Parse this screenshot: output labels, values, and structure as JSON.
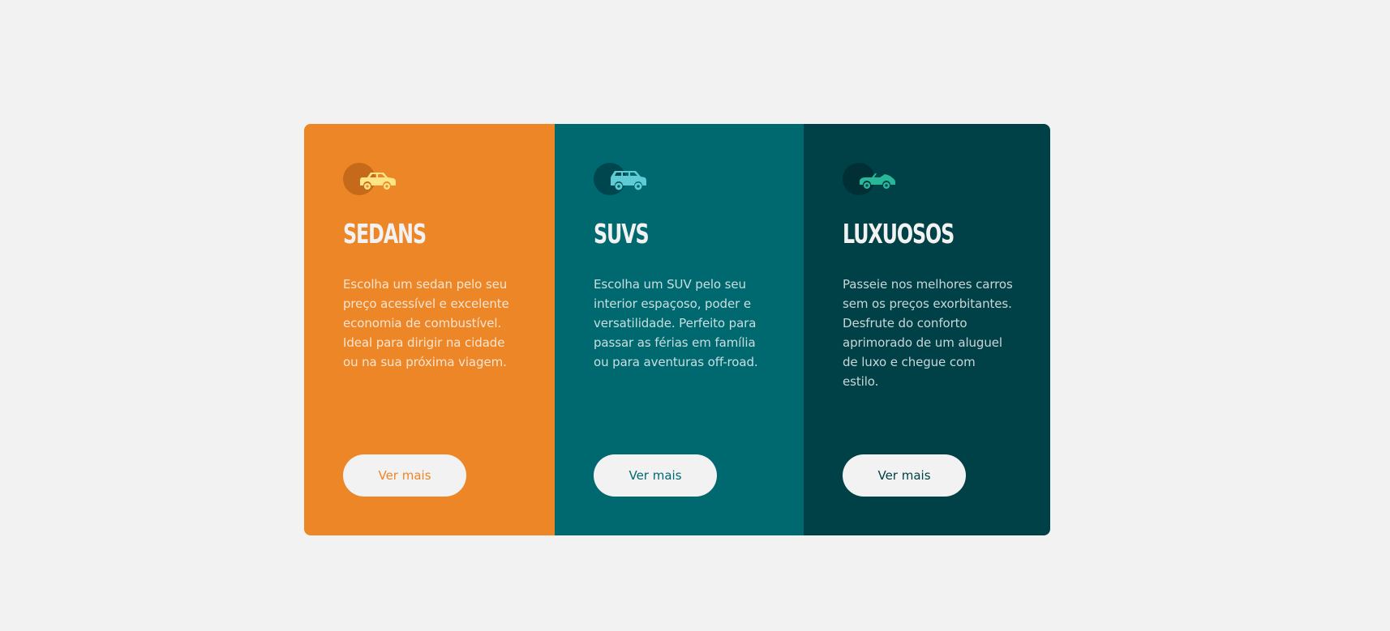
{
  "cards": [
    {
      "key": "sedans",
      "title": "SEDANS",
      "description": "Escolha um sedan pelo seu preço acessível e excelente economia de combustível. Ideal para dirigir na cidade ou na sua próxima viagem.",
      "button_label": "Ver mais",
      "icon": "sedan-car-icon",
      "background": "#ec8627",
      "icon_color": "#ffe484"
    },
    {
      "key": "suvs",
      "title": "SUVS",
      "description": "Escolha um SUV pelo seu interior espaçoso, poder e versatilidade. Perfeito para passar as férias em família ou para aventuras off-road.",
      "button_label": "Ver mais",
      "icon": "suv-car-icon",
      "background": "#006970",
      "icon_color": "#5fcbd4"
    },
    {
      "key": "luxury",
      "title": "LUXUOSOS",
      "description": "Passeie nos melhores carros sem os preços exorbitantes. Desfrute do conforto aprimorado de um aluguel de luxo e chegue com estilo.",
      "button_label": "Ver mais",
      "icon": "luxury-car-icon",
      "background": "#004147",
      "icon_color": "#27b89a"
    }
  ],
  "page_background": "#f2f2f2"
}
